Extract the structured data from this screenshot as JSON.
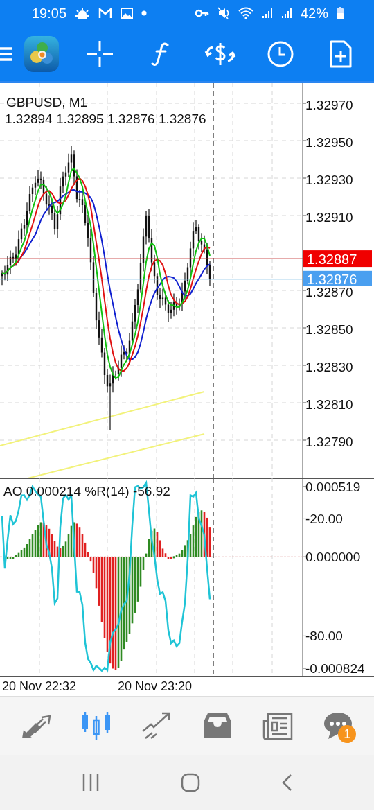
{
  "status_bar": {
    "time": "19:05",
    "battery": "42%"
  },
  "chart": {
    "title": "GBPUSD, M1",
    "ohlc": "1.32894 1.32895 1.32876 1.32876",
    "price_labels": [
      "1.32970",
      "1.32950",
      "1.32930",
      "1.32910",
      "1.32870",
      "1.32850",
      "1.32830",
      "1.32810",
      "1.32790"
    ],
    "ask_tag": "1.32887",
    "bid_tag": "1.32876"
  },
  "indicator": {
    "header": "AO 0.000214 %R(14) -56.92",
    "axis_labels": [
      {
        "kind": "ao",
        "text": "0.000519"
      },
      {
        "kind": "wpr",
        "text": "-20.00"
      },
      {
        "kind": "ao",
        "text": "0.000000"
      },
      {
        "kind": "wpr",
        "text": "-80.00"
      },
      {
        "kind": "ao",
        "text": "-0.000824"
      }
    ]
  },
  "time_labels": [
    "20 Nov 22:32",
    "20 Nov 23:20"
  ],
  "bottom_nav": [
    {
      "kind": "quotes",
      "selected": false
    },
    {
      "kind": "chart",
      "selected": true
    },
    {
      "kind": "trade",
      "selected": false
    },
    {
      "kind": "history",
      "selected": false
    },
    {
      "kind": "news",
      "selected": false
    },
    {
      "kind": "messages",
      "selected": false,
      "badge": "1"
    }
  ]
}
